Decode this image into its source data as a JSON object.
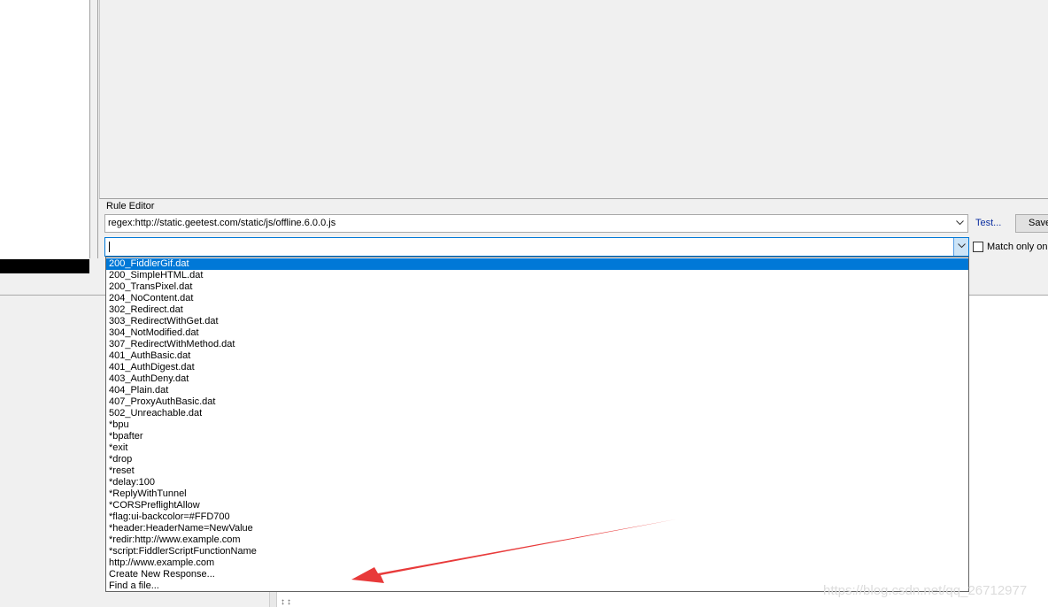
{
  "rule_editor": {
    "label": "Rule Editor",
    "match_value": "regex:http://static.geetest.com/static/js/offline.6.0.0.js",
    "action_value": "",
    "test_label": "Test...",
    "save_label": "Save",
    "match_only_label": "Match only once"
  },
  "dropdown_items": [
    "200_FiddlerGif.dat",
    "200_SimpleHTML.dat",
    "200_TransPixel.dat",
    "204_NoContent.dat",
    "302_Redirect.dat",
    "303_RedirectWithGet.dat",
    "304_NotModified.dat",
    "307_RedirectWithMethod.dat",
    "401_AuthBasic.dat",
    "401_AuthDigest.dat",
    "403_AuthDeny.dat",
    "404_Plain.dat",
    "407_ProxyAuthBasic.dat",
    "502_Unreachable.dat",
    "*bpu",
    "*bpafter",
    "*exit",
    "*drop",
    "*reset",
    "*delay:100",
    "*ReplyWithTunnel",
    "*CORSPreflightAllow",
    "*flag:ui-backcolor=#FFD700",
    "*header:HeaderName=NewValue",
    "*redir:http://www.example.com",
    "*script:FiddlerScriptFunctionName",
    "http://www.example.com",
    "Create New Response...",
    "Find a file..."
  ],
  "selected_index": 0,
  "lower_glyph": "↕↕",
  "watermark": "https://blog.csdn.net/qq_26712977",
  "colors": {
    "selection": "#0078d7",
    "link": "#0b2ea1",
    "annotation_arrow": "#e83a3a"
  },
  "icons": {
    "dropdown": "chevron-down-icon",
    "annotation": "red-arrow-annotation"
  }
}
